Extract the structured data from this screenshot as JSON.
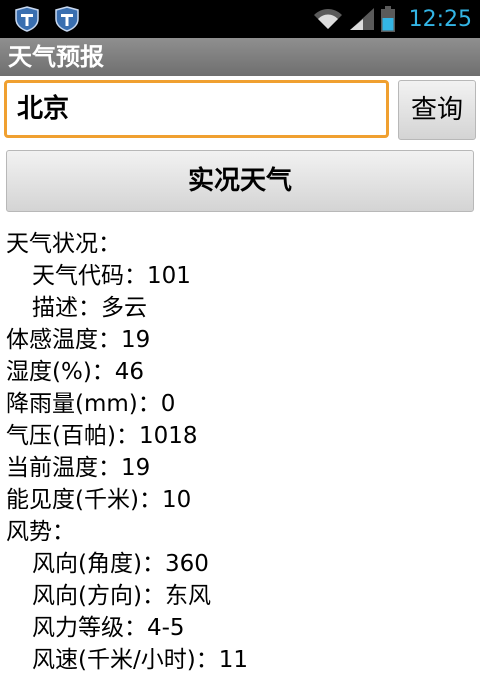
{
  "status_bar": {
    "time": "12:25",
    "icons": [
      "shield-notification-icon",
      "shield-notification-icon",
      "wifi-icon",
      "signal-icon",
      "battery-icon"
    ]
  },
  "app": {
    "title": "天气预报"
  },
  "search": {
    "value": "北京",
    "query_label": "查询"
  },
  "realtime_label": "实况天气",
  "weather": {
    "condition_label": "天气状况：",
    "code_line": "天气代码：101",
    "desc_line": "描述：多云",
    "feels_like_line": "体感温度：19",
    "humidity_line": "湿度(%)：46",
    "rain_line": "降雨量(mm)：0",
    "pressure_line": "气压(百帕)：1018",
    "temp_line": "当前温度：19",
    "visibility_line": "能见度(千米)：10",
    "wind_label": "风势：",
    "wind_deg_line": "风向(角度)：360",
    "wind_dir_line": "风向(方向)：东风",
    "wind_scale_line": "风力等级：4-5",
    "wind_speed_line": "风速(千米/小时)：11"
  },
  "colors": {
    "accent": "#33b5e5",
    "focus": "#f0a030"
  }
}
